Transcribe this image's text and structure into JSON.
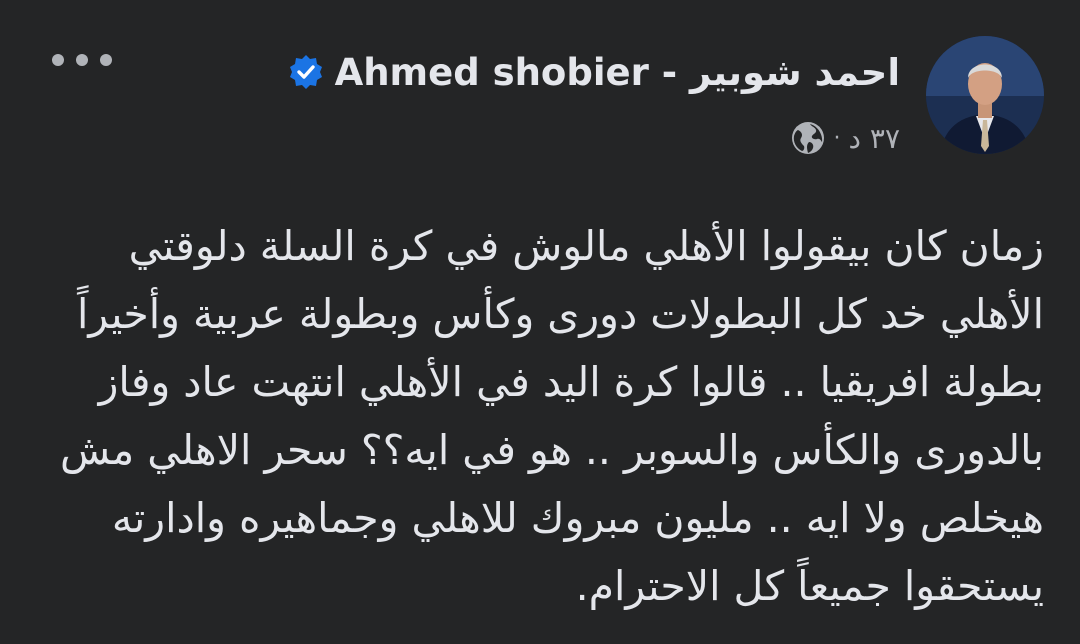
{
  "post": {
    "author": {
      "name": "احمد شوبير - Ahmed shobier",
      "verified": true,
      "avatar_icon": "person-avatar"
    },
    "meta": {
      "time": "٣٧ د",
      "separator": "·",
      "audience_icon": "globe-icon"
    },
    "menu_icon": "more-options-icon",
    "text": "زمان كان بيقولوا الأهلي مالوش في كرة السلة دلوقتي الأهلي خد كل البطولات دورى وكأس وبطولة عربية وأخيراً بطولة افريقيا .. قالوا كرة اليد في الأهلي انتهت عاد وفاز بالدورى والكأس والسوبر .. هو في ايه؟؟ سحر الاهلي مش هيخلص ولا ايه .. مليون مبروك للاهلي وجماهيره وادارته يستحقوا جميعاً كل الاحترام."
  },
  "colors": {
    "background": "#242526",
    "primary_text": "#e4e6eb",
    "secondary_text": "#b0b3b8",
    "verified_badge": "#1b74e4"
  }
}
